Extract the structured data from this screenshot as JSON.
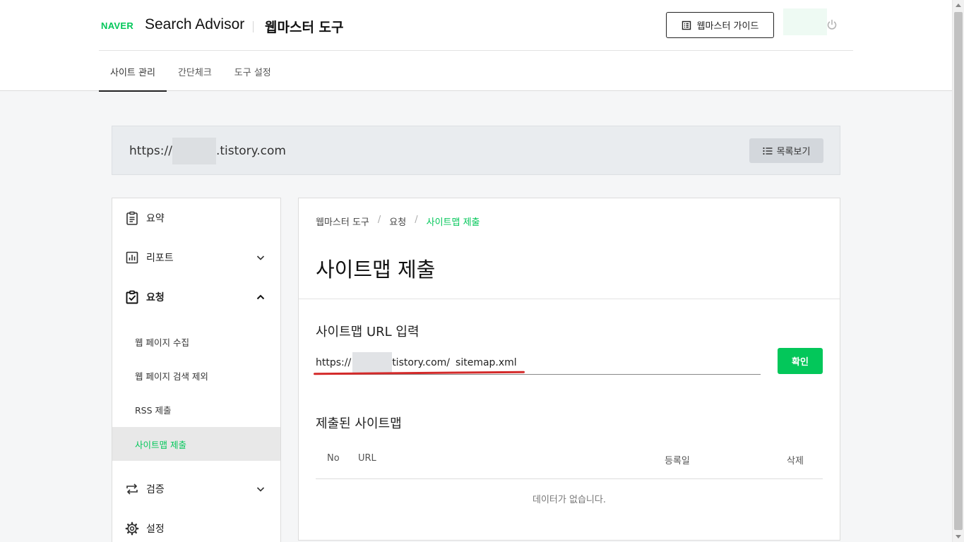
{
  "header": {
    "naver_logo": "NAVER",
    "brand_name": "Search Advisor",
    "tool_title": "웹마스터 도구",
    "guide_button": "웹마스터 가이드",
    "nav_tabs": [
      {
        "label": "사이트 관리",
        "active": true
      },
      {
        "label": "간단체크",
        "active": false
      },
      {
        "label": "도구 설정",
        "active": false
      }
    ]
  },
  "site_bar": {
    "url_prefix": "https://",
    "url_suffix": ".tistory.com",
    "list_button": "목록보기"
  },
  "sidebar": {
    "items": [
      {
        "label": "요약",
        "icon": "clipboard-icon"
      },
      {
        "label": "리포트",
        "icon": "bar-chart-icon",
        "expanded": false
      },
      {
        "label": "요청",
        "icon": "checklist-icon",
        "expanded": true
      },
      {
        "label": "검증",
        "icon": "repeat-icon",
        "expanded": false
      },
      {
        "label": "설정",
        "icon": "gear-icon"
      }
    ],
    "sub_items": [
      {
        "label": "웹 페이지 수집",
        "active": false
      },
      {
        "label": "웹 페이지 검색 제외",
        "active": false
      },
      {
        "label": "RSS 제출",
        "active": false
      },
      {
        "label": "사이트맵 제출",
        "active": true
      }
    ]
  },
  "main": {
    "breadcrumb": [
      "웹마스터 도구",
      "요청",
      "사이트맵 제출"
    ],
    "breadcrumb_sep": "/",
    "page_title": "사이트맵 제출",
    "sitemap_input": {
      "section_title": "사이트맵 URL 입력",
      "url_prefix": "https://",
      "url_suffix": "tistory.com/",
      "value": "sitemap.xml",
      "confirm_button": "확인"
    },
    "submitted": {
      "section_title": "제출된 사이트맵",
      "columns": [
        "No",
        "URL",
        "등록일",
        "삭제"
      ],
      "empty_message": "데이터가 없습니다."
    }
  },
  "colors": {
    "brand_green": "#03c75a",
    "annotation_red": "#d42a2a"
  }
}
